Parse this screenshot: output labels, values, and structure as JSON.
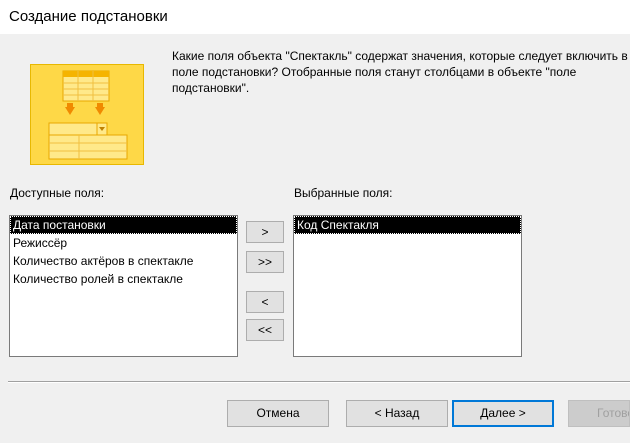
{
  "window": {
    "title": "Создание подстановки"
  },
  "description": "Какие поля объекта \"Спектакль\" содержат значения, которые следует включить в поле подстановки? Отобранные поля станут столбцами в объекте \"поле подстановки\".",
  "available": {
    "label": "Доступные поля:",
    "items": [
      {
        "text": "Дата постановки",
        "selected": true
      },
      {
        "text": "Режиссёр",
        "selected": false
      },
      {
        "text": "Количество актёров в спектакле",
        "selected": false
      },
      {
        "text": "Количество ролей в спектакле",
        "selected": false
      }
    ]
  },
  "selected_fields": {
    "label": "Выбранные поля:",
    "items": [
      {
        "text": "Код Спектакля",
        "selected": true
      }
    ]
  },
  "move_buttons": {
    "add_one": ">",
    "add_all": ">>",
    "remove_one": "<",
    "remove_all": "<<"
  },
  "buttons": {
    "cancel": "Отмена",
    "back": "< Назад",
    "next": "Далее >",
    "finish": "Готово"
  },
  "colors": {
    "wizard_image": "#fed847",
    "selection": "#000000",
    "default_border": "#0078d7"
  }
}
